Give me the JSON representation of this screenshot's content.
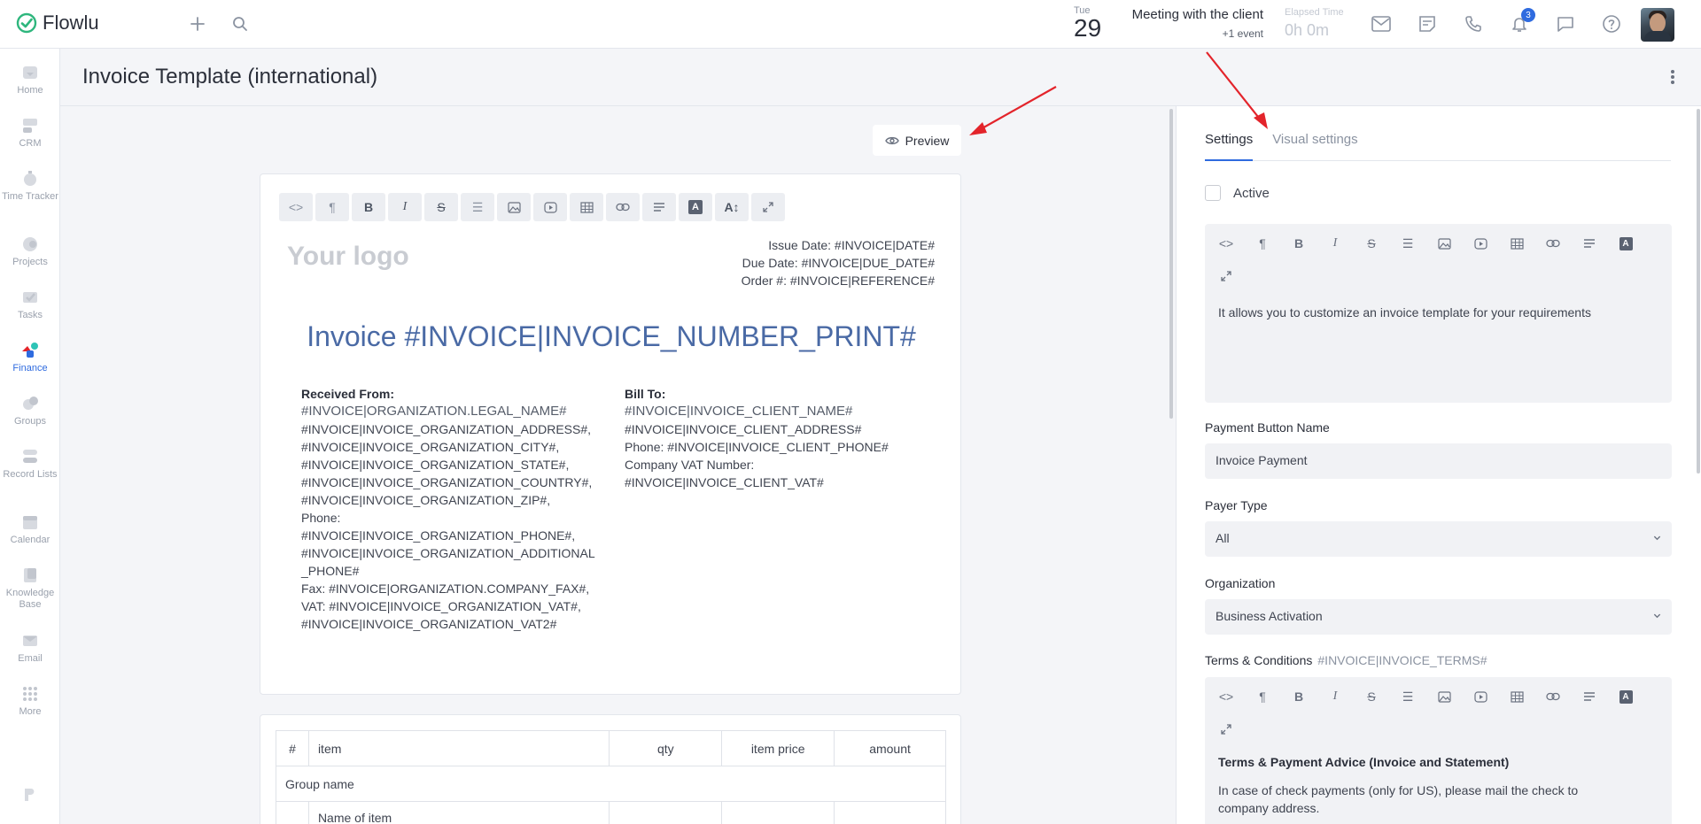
{
  "brand": {
    "name": "Flowlu"
  },
  "topbar": {
    "date": {
      "weekday": "Tue",
      "day": "29"
    },
    "event": {
      "title": "Meeting with the client",
      "more": "+1 event"
    },
    "elapsed": {
      "label": "Elapsed Time",
      "value": "0h 0m"
    },
    "notifications_count": "3"
  },
  "sidebar": {
    "items": [
      {
        "label": "Home"
      },
      {
        "label": "CRM"
      },
      {
        "label": "Time Tracker"
      },
      {
        "label": "Projects"
      },
      {
        "label": "Tasks"
      },
      {
        "label": "Finance"
      },
      {
        "label": "Groups"
      },
      {
        "label": "Record Lists"
      },
      {
        "label": "Calendar"
      },
      {
        "label": "Knowledge Base"
      },
      {
        "label": "Email"
      },
      {
        "label": "More"
      }
    ]
  },
  "page": {
    "title": "Invoice Template (international)"
  },
  "editor": {
    "preview_label": "Preview",
    "logo_placeholder": "Your logo",
    "meta": [
      "Issue Date: #INVOICE|DATE#",
      "Due Date: #INVOICE|DUE_DATE#",
      "Order #: #INVOICE|REFERENCE#"
    ],
    "invoice_title": "Invoice #INVOICE|INVOICE_NUMBER_PRINT#",
    "received_from": {
      "heading": "Received From:",
      "name": "#INVOICE|ORGANIZATION.LEGAL_NAME#",
      "lines": [
        "#INVOICE|INVOICE_ORGANIZATION_ADDRESS#,",
        "#INVOICE|INVOICE_ORGANIZATION_CITY#,",
        "#INVOICE|INVOICE_ORGANIZATION_STATE#,",
        "#INVOICE|INVOICE_ORGANIZATION_COUNTRY#,",
        "#INVOICE|INVOICE_ORGANIZATION_ZIP#,",
        "Phone:",
        "#INVOICE|INVOICE_ORGANIZATION_PHONE#,",
        "#INVOICE|INVOICE_ORGANIZATION_ADDITIONAL",
        "_PHONE#",
        "Fax: #INVOICE|ORGANIZATION.COMPANY_FAX#,",
        "VAT: #INVOICE|INVOICE_ORGANIZATION_VAT#,",
        "#INVOICE|INVOICE_ORGANIZATION_VAT2#"
      ]
    },
    "bill_to": {
      "heading": "Bill To:",
      "name": "#INVOICE|INVOICE_CLIENT_NAME#",
      "lines": [
        "#INVOICE|INVOICE_CLIENT_ADDRESS#",
        "Phone: #INVOICE|INVOICE_CLIENT_PHONE#",
        "Company VAT Number:",
        "#INVOICE|INVOICE_CLIENT_VAT#"
      ]
    },
    "table": {
      "headers": [
        "#",
        "item",
        "qty",
        "item price",
        "amount"
      ],
      "group_name": "Group name",
      "item_name": "Name of item"
    }
  },
  "settings": {
    "tabs": [
      "Settings",
      "Visual settings"
    ],
    "active_label": "Active",
    "description": "It allows you to customize an invoice template for your requirements",
    "payment_button": {
      "label": "Payment Button Name",
      "value": "Invoice Payment"
    },
    "payer_type": {
      "label": "Payer Type",
      "value": "All"
    },
    "organization": {
      "label": "Organization",
      "value": "Business Activation"
    },
    "terms": {
      "label": "Terms & Conditions",
      "hint": "#INVOICE|INVOICE_TERMS#",
      "heading": "Terms & Payment Advice (Invoice and Statement)",
      "text_1": "In case of check payments (only for US), please mail the check to",
      "text_2": "company address."
    }
  },
  "colors": {
    "accent": "#2f6bdf",
    "brand_green": "#2eb67d",
    "arrow": "#e3242b",
    "invoice_title": "#4a6aa5"
  }
}
